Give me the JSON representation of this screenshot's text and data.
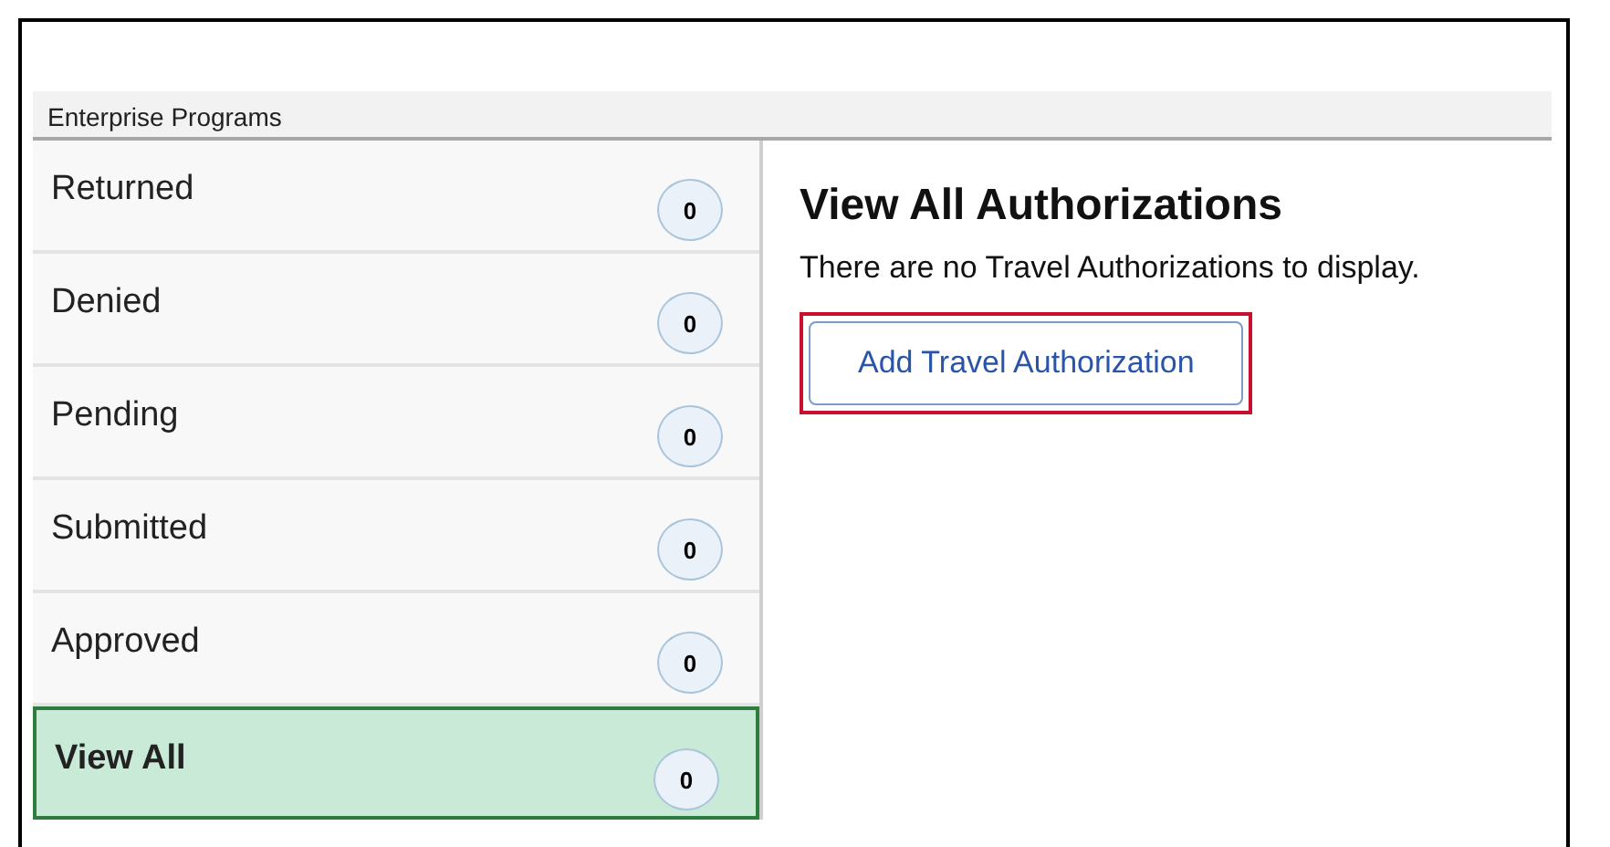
{
  "header": {
    "title": "Enterprise Programs"
  },
  "sidebar": {
    "items": [
      {
        "label": "Returned",
        "count": "0",
        "selected": false
      },
      {
        "label": "Denied",
        "count": "0",
        "selected": false
      },
      {
        "label": "Pending",
        "count": "0",
        "selected": false
      },
      {
        "label": "Submitted",
        "count": "0",
        "selected": false
      },
      {
        "label": "Approved",
        "count": "0",
        "selected": false
      },
      {
        "label": "View All",
        "count": "0",
        "selected": true
      }
    ]
  },
  "main": {
    "title": "View All Authorizations",
    "message": "There are no Travel Authorizations to display.",
    "button": {
      "label": "Add Travel Authorization",
      "highlighted": true
    }
  }
}
